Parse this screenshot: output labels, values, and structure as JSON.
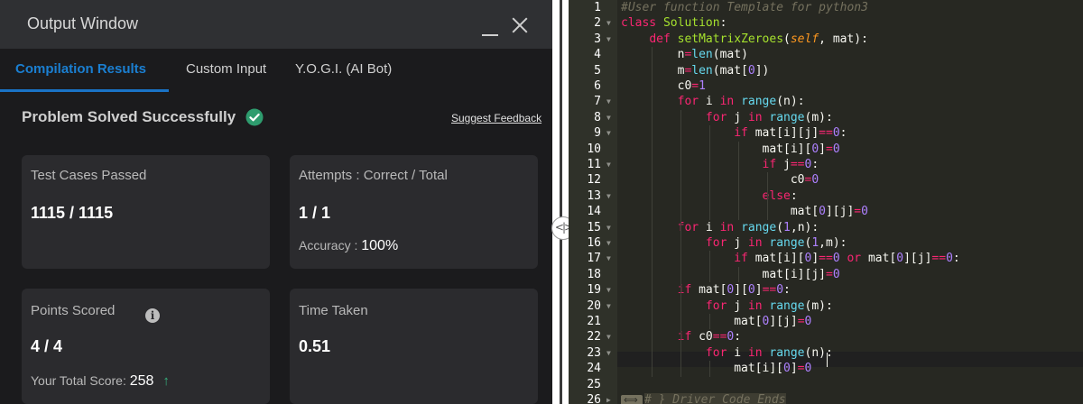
{
  "output_window": {
    "title": "Output Window",
    "tabs": [
      {
        "label": "Compilation Results",
        "active": true
      },
      {
        "label": "Custom Input",
        "active": false
      },
      {
        "label": "Y.O.G.I. (AI Bot)",
        "active": false
      }
    ],
    "status": "Problem Solved Successfully",
    "suggest_feedback": "Suggest Feedback",
    "cards": {
      "test_cases": {
        "label": "Test Cases Passed",
        "value": "1115 / 1115"
      },
      "attempts": {
        "label": "Attempts : Correct / Total",
        "value": "1 / 1",
        "accuracy_label": "Accuracy :",
        "accuracy_value": "100%"
      },
      "points": {
        "label": "Points Scored",
        "value": "4 / 4",
        "total_label": "Your Total Score:",
        "total_value": "258"
      },
      "time": {
        "label": "Time Taken",
        "value": "0.51"
      }
    },
    "colors": {
      "accent": "#1b7fd1",
      "success": "#36b37e",
      "card_bg": "#2b2b2e",
      "panel_bg": "#1b1b1d"
    }
  },
  "editor": {
    "line_numbers": [
      "1",
      "2",
      "3",
      "4",
      "5",
      "6",
      "7",
      "8",
      "9",
      "10",
      "11",
      "12",
      "13",
      "14",
      "15",
      "16",
      "17",
      "18",
      "19",
      "20",
      "21",
      "22",
      "23",
      "24",
      "25",
      "26"
    ],
    "lines": [
      "#User function Template for python3",
      "class Solution:",
      "    def setMatrixZeroes(self, mat):",
      "        n=len(mat)",
      "        m=len(mat[0])",
      "        c0=1",
      "        for i in range(n):",
      "            for j in range(m):",
      "                if mat[i][j]==0:",
      "                    mat[i][0]=0",
      "                    if j==0:",
      "                        c0=0",
      "                    else:",
      "                        mat[0][j]=0",
      "        for i in range(1,n):",
      "            for j in range(1,m):",
      "                if mat[i][0]==0 or mat[0][j]==0:",
      "                    mat[i][j]=0",
      "        if mat[0][0]==0:",
      "            for j in range(m):",
      "                mat[0][j]=0",
      "        if c0==0:",
      "            for i in range(n):",
      "                mat[i][0]=0",
      "",
      "# } Driver Code Ends"
    ],
    "colors": {
      "background": "#272822",
      "keyword": "#f92672",
      "function": "#a6e22e",
      "number": "#ae81ff",
      "comment": "#75715e"
    }
  }
}
